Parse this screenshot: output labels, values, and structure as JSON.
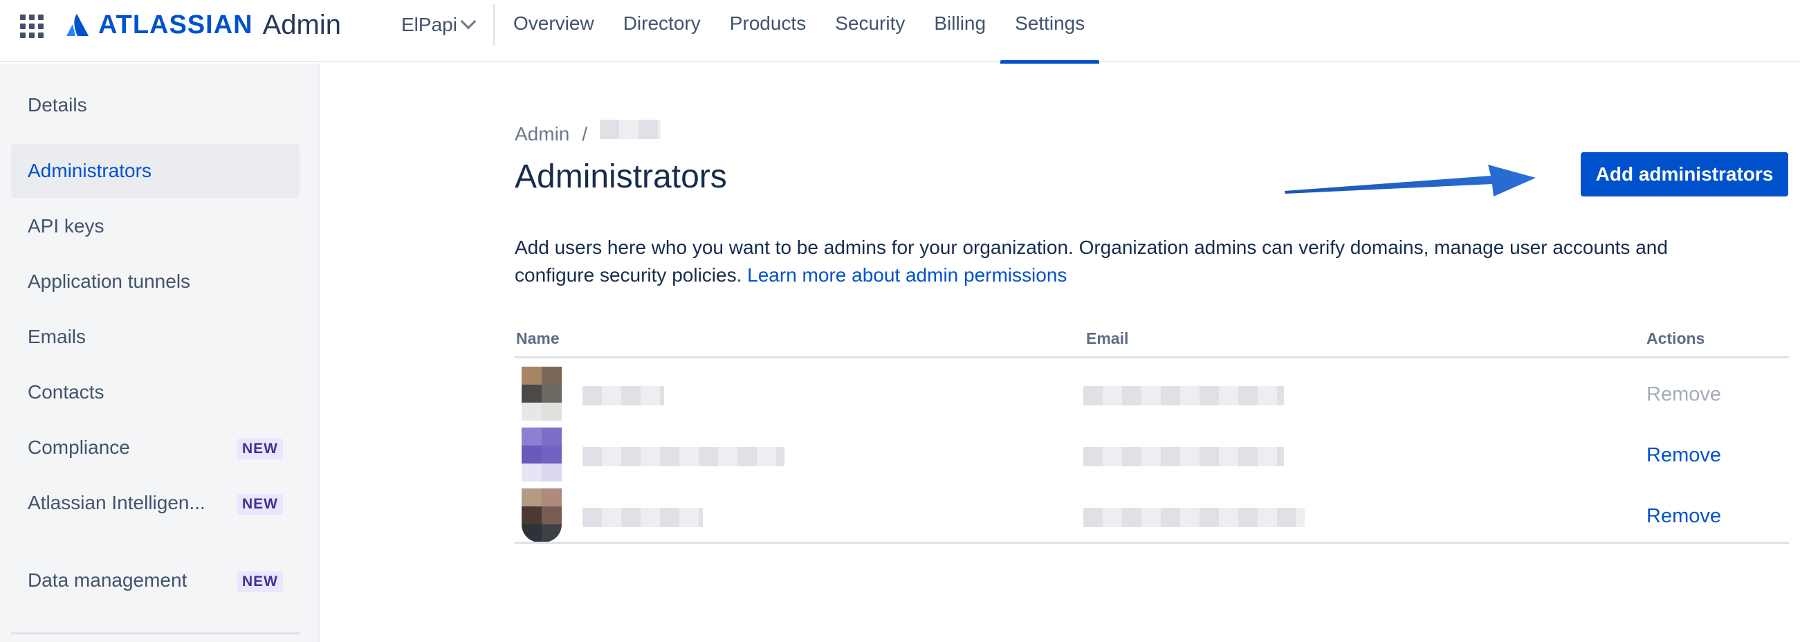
{
  "topnav": {
    "brand": "ATLASSIAN",
    "product": "Admin",
    "org_name": "ElPapi",
    "tabs": [
      {
        "label": "Overview"
      },
      {
        "label": "Directory"
      },
      {
        "label": "Products"
      },
      {
        "label": "Security"
      },
      {
        "label": "Billing"
      },
      {
        "label": "Settings",
        "active": true
      }
    ]
  },
  "sidebar": {
    "items": [
      {
        "label": "Details"
      },
      {
        "label": "Administrators",
        "active": true
      },
      {
        "label": "API keys"
      },
      {
        "label": "Application tunnels"
      },
      {
        "label": "Emails"
      },
      {
        "label": "Contacts"
      },
      {
        "label": "Compliance",
        "badge": "NEW"
      },
      {
        "label": "Atlassian Intelligen...",
        "badge": "NEW"
      },
      {
        "label": "Data management",
        "badge": "NEW"
      }
    ]
  },
  "main": {
    "breadcrumb_root": "Admin",
    "breadcrumb_sep": "/",
    "title": "Administrators",
    "add_button": "Add administrators",
    "description": "Add users here who you want to be admins for your organization. Organization admins can verify domains, manage user accounts and configure security policies.",
    "learn_more": "Learn more about admin permissions",
    "table": {
      "headers": {
        "name": "Name",
        "email": "Email",
        "actions": "Actions"
      },
      "rows": [
        {
          "action": "Remove",
          "action_enabled": false
        },
        {
          "action": "Remove",
          "action_enabled": true
        },
        {
          "action": "Remove",
          "action_enabled": true
        }
      ]
    }
  },
  "colors": {
    "brand_blue": "#0052cc",
    "text_primary": "#172b4d",
    "text_subtle": "#42526e",
    "sidebar_bg": "#f4f5f7",
    "badge_bg": "#eae6ff",
    "badge_text": "#403294",
    "disabled": "#a5adba"
  },
  "icons": [
    "app-switcher-icon",
    "atlassian-logo-icon",
    "chevron-down-icon",
    "arrow-annotation-icon"
  ]
}
